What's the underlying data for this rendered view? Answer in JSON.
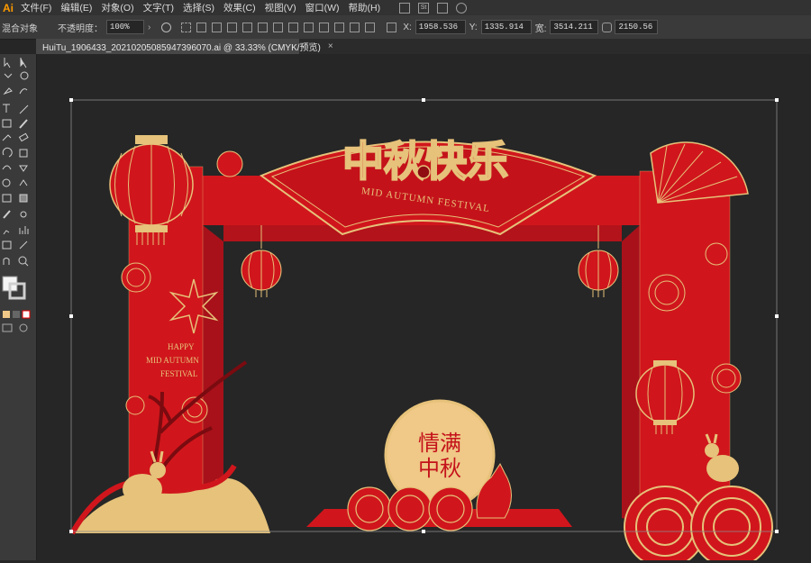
{
  "app": {
    "logo": "Ai"
  },
  "menu": [
    "文件(F)",
    "编辑(E)",
    "对象(O)",
    "文字(T)",
    "选择(S)",
    "效果(C)",
    "视图(V)",
    "窗口(W)",
    "帮助(H)"
  ],
  "menu_extra": {
    "stock_label": "St"
  },
  "control": {
    "left_label": "混合对象",
    "opacity_label": "不透明度：",
    "opacity_value": "100%",
    "x_label": "X:",
    "x_value": "1958.536",
    "y_label": "Y:",
    "y_value": "1335.914",
    "w_label": "宽:",
    "w_value": "3514.211",
    "h_value": "2150.56"
  },
  "document_tab": {
    "title": "HuiTu_1906433_20210205085947396070.ai  @  33.33% (CMYK/预览)",
    "close": "×"
  },
  "artwork": {
    "title_text": "中秋快乐",
    "banner_text": "MID AUTUMN FESTIVAL",
    "side_text": [
      "HAPPY",
      "MID AUTUMN",
      "FESTIVAL"
    ],
    "moon_text_1": "情满",
    "moon_text_2": "中秋",
    "colors": {
      "red": "#d0161c",
      "dark_red": "#9e0f14",
      "gold": "#e6c27a",
      "moon": "#f0c887"
    }
  },
  "icons": [
    "selection-tool-icon",
    "direct-selection-icon",
    "pen-tool-icon",
    "type-tool-icon",
    "line-tool-icon",
    "rectangle-tool-icon",
    "paintbrush-icon",
    "eraser-icon",
    "rotate-icon",
    "scale-icon",
    "width-icon",
    "shape-builder-icon",
    "eyedropper-icon",
    "graph-icon",
    "hand-icon",
    "zoom-icon",
    "fill-stroke-icon"
  ]
}
